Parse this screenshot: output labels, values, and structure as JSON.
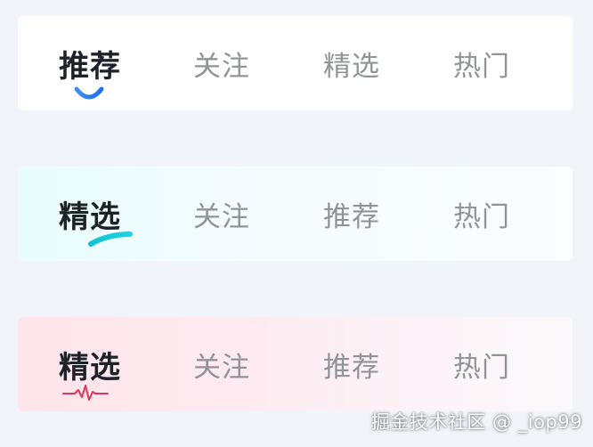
{
  "colors": {
    "page_background": "#f1f5fa",
    "active_text": "#1d2129",
    "inactive_text": "#909499",
    "indicator_blue": "#2b7bf3",
    "indicator_cyan": "#14c6d6",
    "indicator_pink": "#e0345a"
  },
  "tab_bars": [
    {
      "style": "smile-indicator",
      "tabs": [
        {
          "label": "推荐",
          "active": true
        },
        {
          "label": "关注",
          "active": false
        },
        {
          "label": "精选",
          "active": false
        },
        {
          "label": "热门",
          "active": false
        }
      ]
    },
    {
      "style": "brush-indicator",
      "tabs": [
        {
          "label": "精选",
          "active": true
        },
        {
          "label": "关注",
          "active": false
        },
        {
          "label": "推荐",
          "active": false
        },
        {
          "label": "热门",
          "active": false
        }
      ]
    },
    {
      "style": "pulse-indicator",
      "tabs": [
        {
          "label": "精选",
          "active": true
        },
        {
          "label": "关注",
          "active": false
        },
        {
          "label": "推荐",
          "active": false
        },
        {
          "label": "热门",
          "active": false
        }
      ]
    }
  ],
  "watermark": "掘金技术社区 @ _iop99"
}
